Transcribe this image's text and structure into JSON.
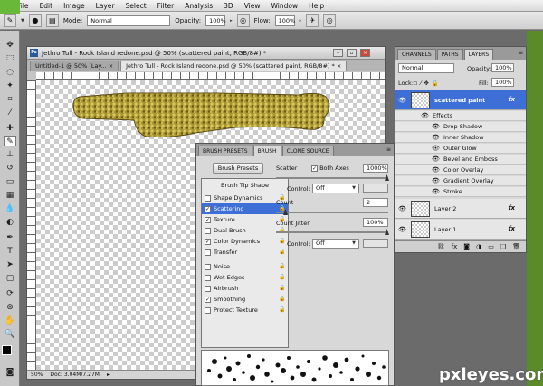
{
  "menubar": {
    "logo": "Ps",
    "items": [
      "File",
      "Edit",
      "Image",
      "Layer",
      "Select",
      "Filter",
      "Analysis",
      "3D",
      "View",
      "Window",
      "Help"
    ]
  },
  "options": {
    "mode_label": "Mode:",
    "mode_value": "Normal",
    "opacity_label": "Opacity:",
    "opacity_value": "100%",
    "flow_label": "Flow:",
    "flow_value": "100%"
  },
  "document": {
    "title": "Jethro Tull - Rock Island redone.psd @ 50% (scattered paint, RGB/8#) *",
    "tabs": [
      {
        "label": "Untitled-1 @ 50% (Lay...",
        "close": "×"
      },
      {
        "label": "Jethro Tull - Rock Island redone.psd @ 50% (scattered paint, RGB/8#) *",
        "close": "×"
      }
    ],
    "zoom": "50%",
    "doc_info": "Doc: 3.04M/7.27M"
  },
  "brush_panel": {
    "tabs": [
      "BRUSH PRESETS",
      "BRUSH",
      "CLONE SOURCE"
    ],
    "presets_button": "Brush Presets",
    "list_header": "Brush Tip Shape",
    "items": [
      {
        "label": "Shape Dynamics",
        "checked": false,
        "selected": false
      },
      {
        "label": "Scattering",
        "checked": true,
        "selected": true
      },
      {
        "label": "Texture",
        "checked": true,
        "selected": false
      },
      {
        "label": "Dual Brush",
        "checked": false,
        "selected": false
      },
      {
        "label": "Color Dynamics",
        "checked": true,
        "selected": false
      },
      {
        "label": "Transfer",
        "checked": false,
        "selected": false
      },
      {
        "label": "Noise",
        "checked": false,
        "selected": false
      },
      {
        "label": "Wet Edges",
        "checked": false,
        "selected": false
      },
      {
        "label": "Airbrush",
        "checked": false,
        "selected": false
      },
      {
        "label": "Smoothing",
        "checked": true,
        "selected": false
      },
      {
        "label": "Protect Texture",
        "checked": false,
        "selected": false
      }
    ],
    "scatter_label": "Scatter",
    "both_axes_label": "Both Axes",
    "scatter_value": "1000%",
    "control_label": "Control:",
    "control_value": "Off",
    "count_label": "Count",
    "count_value": "2",
    "count_jitter_label": "Count Jitter",
    "count_jitter_value": "100%",
    "control2_label": "Control:",
    "control2_value": "Off"
  },
  "layers_panel": {
    "tabs": [
      "CHANNELS",
      "PATHS",
      "LAYERS"
    ],
    "blend_mode": "Normal",
    "opacity_label": "Opacity:",
    "opacity_value": "100%",
    "lock_label": "Lock:",
    "fill_label": "Fill:",
    "fill_value": "100%",
    "selected_layer": "scattered paint",
    "effects_label": "Effects",
    "effects": [
      "Drop Shadow",
      "Inner Shadow",
      "Outer Glow",
      "Bevel and Emboss",
      "Color Overlay",
      "Gradient Overlay",
      "Stroke"
    ],
    "other_layers": [
      "Layer 2",
      "Layer 1"
    ],
    "fx": "fx"
  },
  "watermark": "pxleyes.com",
  "colors": {
    "selection_blue": "#3d6fd6",
    "gold": "#b8a23a"
  }
}
